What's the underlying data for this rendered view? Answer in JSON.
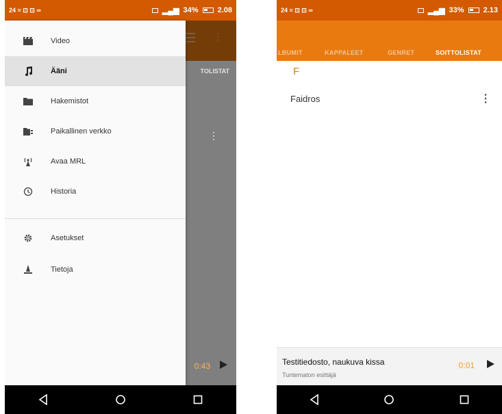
{
  "left_phone": {
    "status": {
      "left_icons": "24 ≡ ⊡ ⊡ ∞",
      "right_text": "34%",
      "time": "2.08"
    },
    "background": {
      "tab_text": "TOLISTAT",
      "time": "0:43"
    },
    "drawer": {
      "items": [
        {
          "label": "Video",
          "icon": "movie-icon"
        },
        {
          "label": "Ääni",
          "icon": "music-note-icon"
        },
        {
          "label": "Hakemistot",
          "icon": "folder-icon"
        },
        {
          "label": "Paikallinen verkko",
          "icon": "network-folder-icon"
        },
        {
          "label": "Avaa MRL",
          "icon": "antenna-icon"
        },
        {
          "label": "Historia",
          "icon": "history-icon"
        },
        {
          "label": "Asetukset",
          "icon": "gear-icon"
        },
        {
          "label": "Tietoja",
          "icon": "vlc-cone-icon"
        }
      ]
    }
  },
  "right_phone": {
    "status": {
      "right_text": "33%",
      "time": "2.13"
    },
    "tabs": [
      "LBUMIT",
      "KAPPALEET",
      "GENRET",
      "SOITTOLISTAT"
    ],
    "section_letter": "F",
    "playlists": [
      {
        "name": "Faidros"
      }
    ],
    "miniplayer": {
      "title": "Testitiedosto, naukuva kissa",
      "artist": "Tuntematon esittäjä",
      "time": "0:01"
    }
  },
  "colors": {
    "status_bar": "#d35a00",
    "app_bar": "#e87a10",
    "accent": "#e87a10",
    "nav_bar": "#000000"
  }
}
